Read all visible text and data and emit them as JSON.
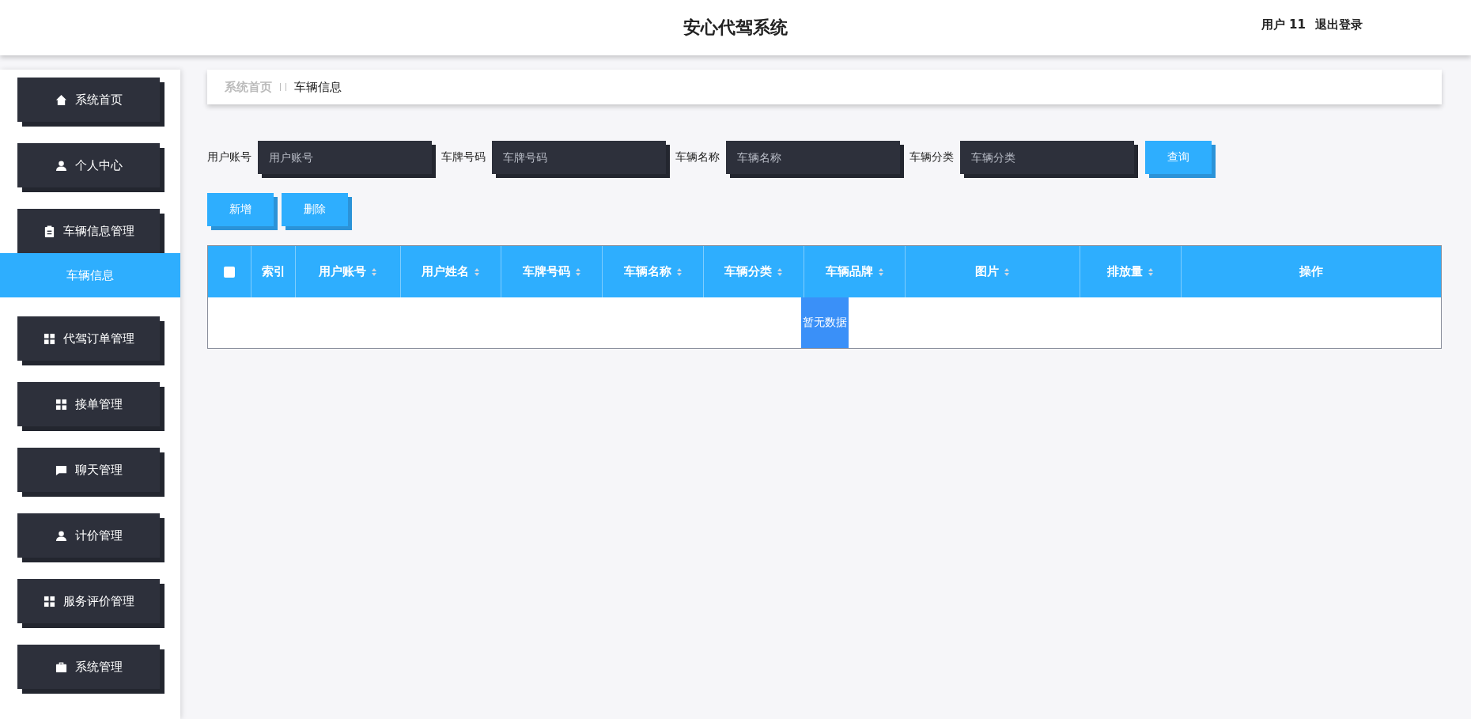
{
  "header": {
    "title": "安心代驾系统",
    "user": "用户 11",
    "logout": "退出登录"
  },
  "sidebar": {
    "items": [
      {
        "label": "系统首页",
        "kind": "home"
      },
      {
        "label": "个人中心",
        "kind": "user"
      },
      {
        "label": "车辆信息管理",
        "kind": "clipboard",
        "children": [
          {
            "label": "车辆信息",
            "selected": true
          }
        ]
      },
      {
        "label": "代驾订单管理",
        "kind": "grid"
      },
      {
        "label": "接单管理",
        "kind": "grid"
      },
      {
        "label": "聊天管理",
        "kind": "chat"
      },
      {
        "label": "计价管理",
        "kind": "user"
      },
      {
        "label": "服务评价管理",
        "kind": "grid"
      },
      {
        "label": "系统管理",
        "kind": "briefcase"
      }
    ]
  },
  "breadcrumb": [
    "系统首页",
    "车辆信息"
  ],
  "filters": [
    {
      "label": "用户账号",
      "placeholder": "用户账号"
    },
    {
      "label": "车牌号码",
      "placeholder": "车牌号码"
    },
    {
      "label": "车辆名称",
      "placeholder": "车辆名称"
    },
    {
      "label": "车辆分类",
      "placeholder": "车辆分类"
    }
  ],
  "search_button": "查询",
  "actions": [
    "新增",
    "删除"
  ],
  "table": {
    "select_all": {
      "checked": false
    },
    "columns": [
      {
        "label": "索引",
        "sortable": false
      },
      {
        "label": "用户账号",
        "sortable": true
      },
      {
        "label": "用户姓名",
        "sortable": true
      },
      {
        "label": "车牌号码",
        "sortable": true
      },
      {
        "label": "车辆名称",
        "sortable": true
      },
      {
        "label": "车辆分类",
        "sortable": true
      },
      {
        "label": "车辆品牌",
        "sortable": true
      },
      {
        "label": "图片",
        "sortable": true
      },
      {
        "label": "排放量",
        "sortable": true
      },
      {
        "label": "操作",
        "sortable": false
      }
    ],
    "empty_text": "暂无数据"
  }
}
